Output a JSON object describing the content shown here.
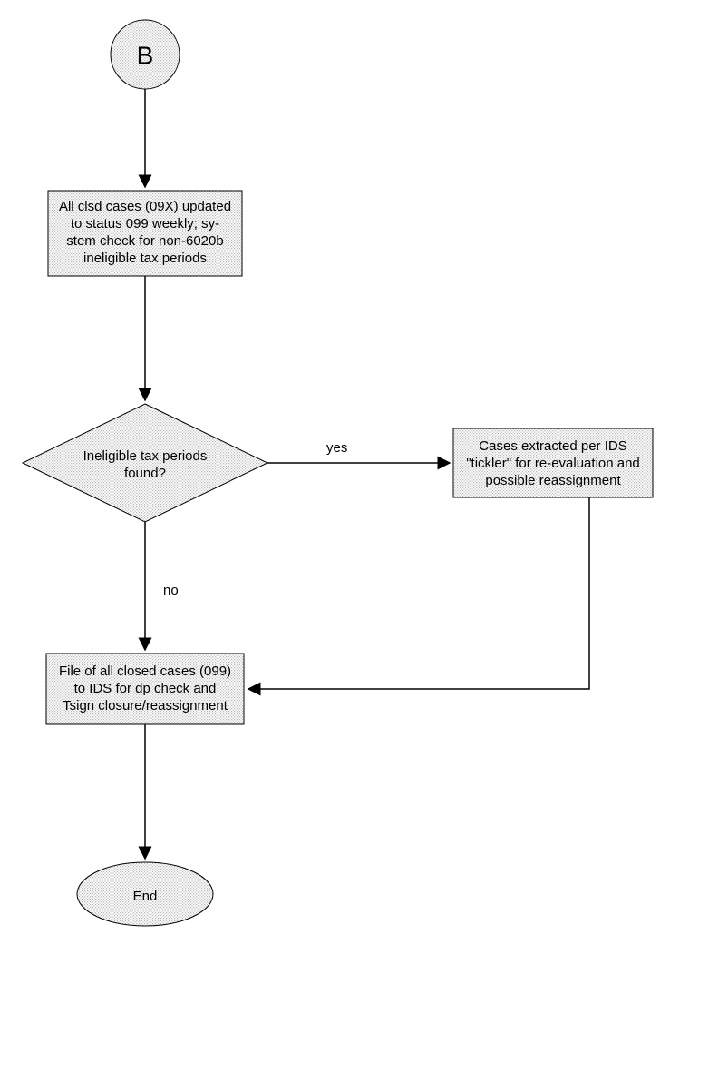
{
  "flowchart": {
    "connector_label": "B",
    "process1": {
      "l1": "All clsd cases (09X) updated",
      "l2": "to status 099 weekly; sy-",
      "l3": "stem check for non-6020b",
      "l4": "ineligible tax periods"
    },
    "decision": {
      "l1": "Ineligible tax periods",
      "l2": "found?"
    },
    "process_yes": {
      "l1": "Cases extracted per IDS",
      "l2": "\"tickler\" for re-evaluation and",
      "l3": "possible reassignment"
    },
    "process2": {
      "l1": "File of all closed cases (099)",
      "l2": "to IDS for dp check and",
      "l3": "Tsign closure/reassignment"
    },
    "terminator": "End",
    "edge_yes": "yes",
    "edge_no": "no"
  }
}
